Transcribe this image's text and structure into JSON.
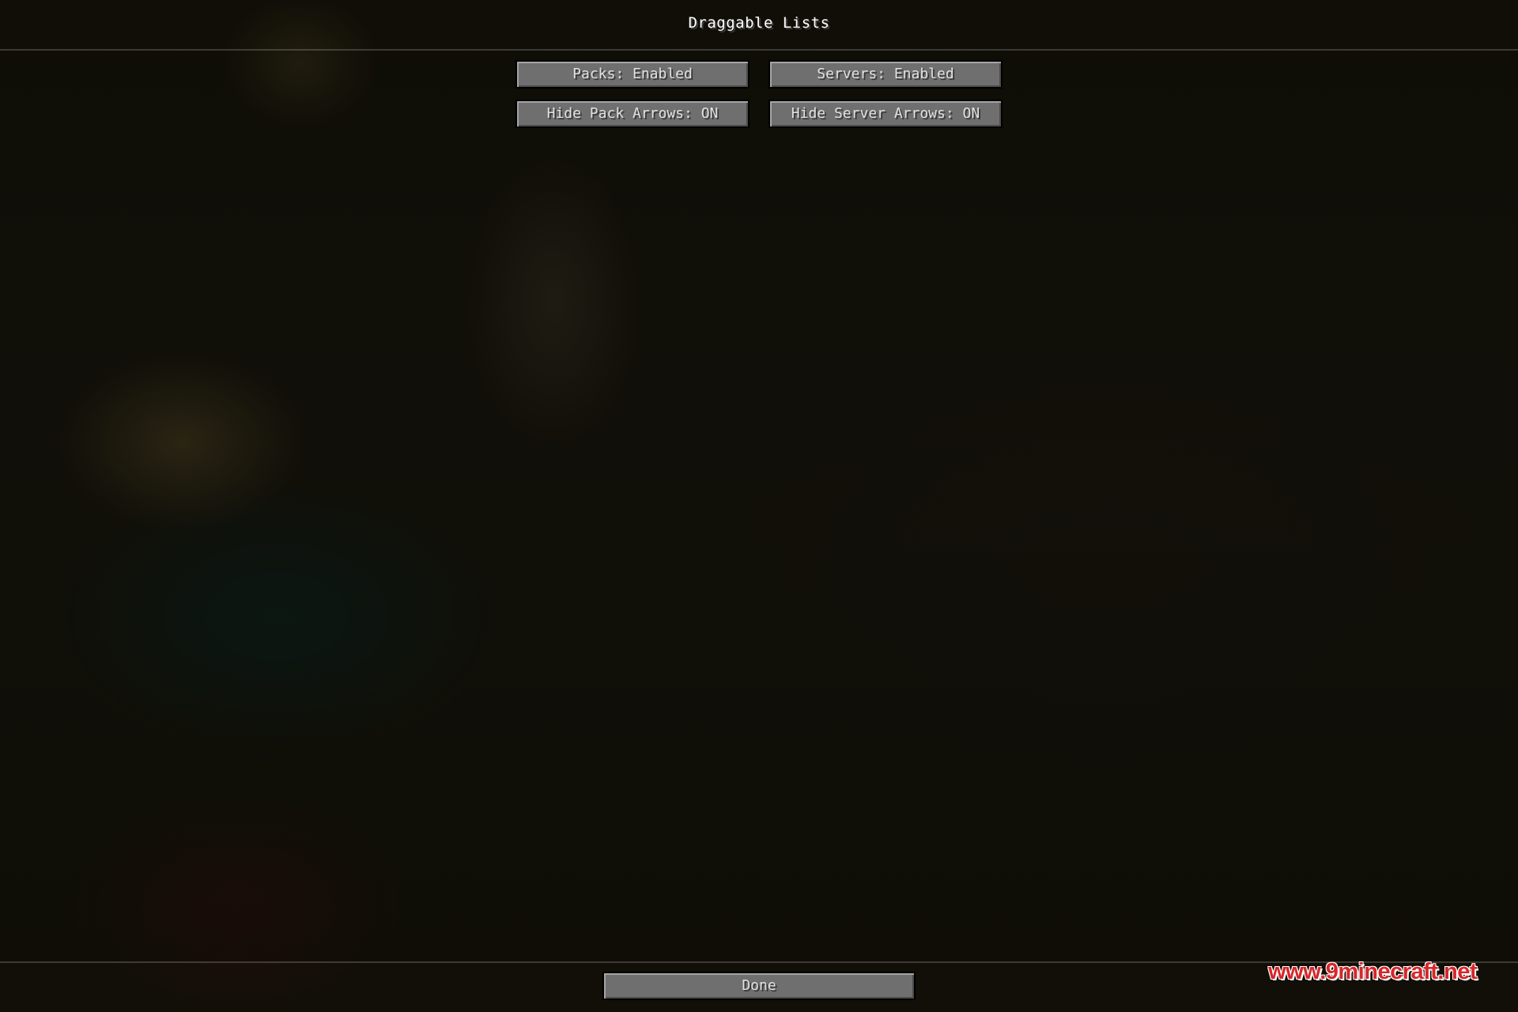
{
  "screen": {
    "title": "Draggable Lists"
  },
  "options": {
    "packs_label": "Packs: Enabled",
    "servers_label": "Servers: Enabled",
    "hide_pack_arrows_label": "Hide Pack Arrows: ON",
    "hide_server_arrows_label": "Hide Server Arrows: ON"
  },
  "footer": {
    "done_label": "Done"
  },
  "watermark": {
    "text": "www.9minecraft.net",
    "color": "#d8262a"
  }
}
